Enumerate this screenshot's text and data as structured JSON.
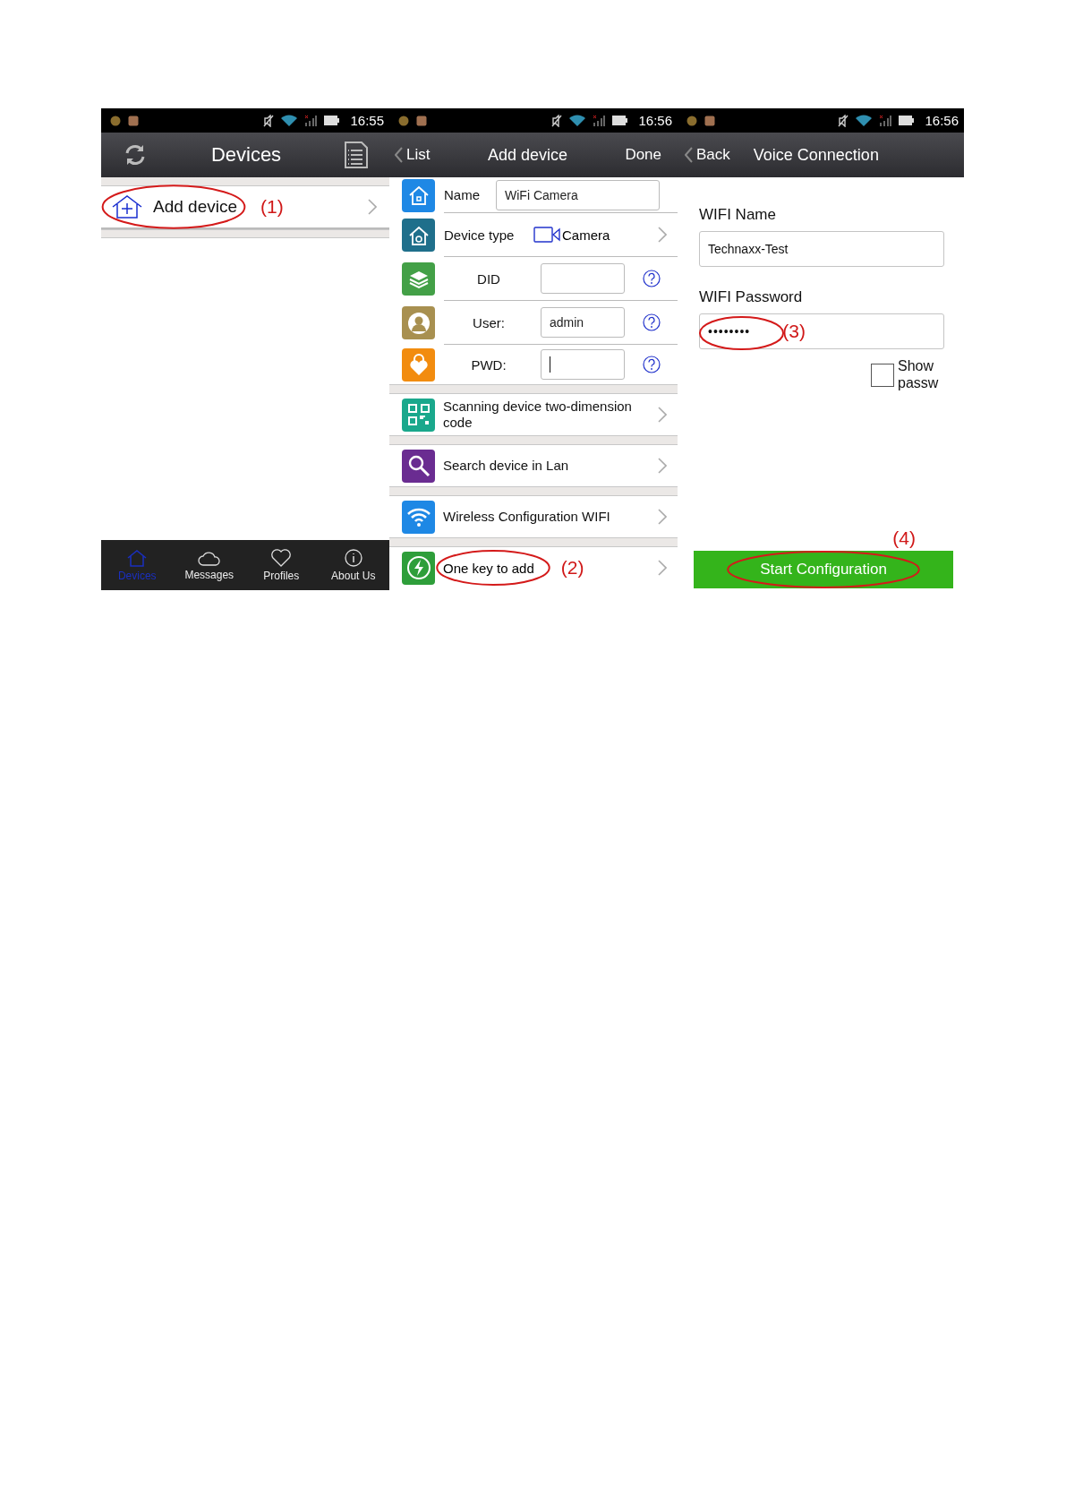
{
  "screens": [
    {
      "kind": "devices",
      "status": {
        "time": "16:55"
      },
      "nav": {
        "title": "Devices"
      },
      "items": [
        {
          "label": "Add device",
          "annotation": "(1)",
          "circled": true
        }
      ],
      "tabs": [
        {
          "label": "Devices",
          "selected": true
        },
        {
          "label": "Messages",
          "selected": false
        },
        {
          "label": "Profiles",
          "selected": false
        },
        {
          "label": "About Us",
          "selected": false
        }
      ]
    },
    {
      "kind": "add_device",
      "status": {
        "time": "16:56"
      },
      "nav": {
        "back": "List",
        "title": "Add device",
        "action": "Done"
      },
      "fields": [
        {
          "kind": "text",
          "label": "Name",
          "value": "WiFi Camera",
          "color": "#1e88e5"
        },
        {
          "kind": "select",
          "label": "Device type",
          "value": "Camera",
          "color": "#1f6f8b"
        },
        {
          "kind": "credential",
          "label": "DID",
          "color": "#43a047"
        },
        {
          "kind": "credential",
          "label": "User:",
          "value": "admin",
          "color": "#a89050"
        },
        {
          "kind": "credential",
          "label": "PWD:",
          "focused": true,
          "color": "#f28c0f"
        }
      ],
      "options": [
        {
          "label": "Scanning device two-dimension code",
          "color": "#1aa88c",
          "circled": false
        },
        {
          "label": "Search device in Lan",
          "color": "#6a2c91",
          "circled": false
        },
        {
          "label": "Wireless Configuration WIFI",
          "color": "#1e88e5",
          "circled": false
        },
        {
          "label": "One key to add",
          "color": "#2e9e3a",
          "annotation": "(2)",
          "circled": true
        }
      ]
    },
    {
      "kind": "voice",
      "status": {
        "time": "16:56"
      },
      "nav": {
        "back": "Back",
        "title": "Voice Connection"
      },
      "wifi_name": {
        "label": "WIFI Name",
        "value": "Technaxx-Test"
      },
      "wifi_password": {
        "label": "WIFI Password",
        "value": "••••••••",
        "annotation": "(3)",
        "circled": true
      },
      "show_password": {
        "label": "Show passw",
        "checked": false
      },
      "start_button": {
        "label": "Start Configuration",
        "annotation": "(4)",
        "circled": true
      }
    }
  ]
}
